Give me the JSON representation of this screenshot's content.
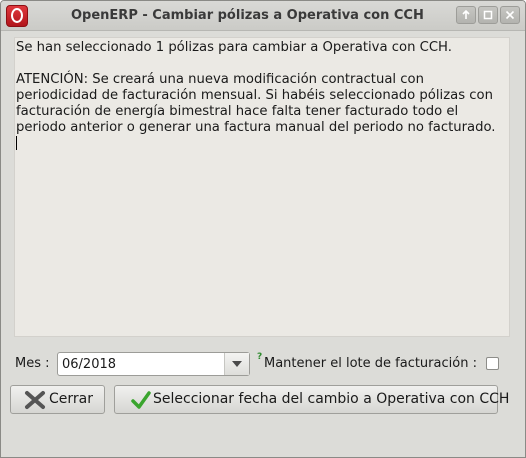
{
  "window": {
    "title": "OpenERP - Cambiar pólizas a Operativa con CCH",
    "app_icon": "openerp-logo-icon",
    "controls": [
      "pin-icon",
      "maximize-icon",
      "close-icon"
    ]
  },
  "message": {
    "line1": "Se han seleccionado 1 pólizas para cambiar a Operativa con CCH.",
    "warning": "ATENCIÓN: Se creará una nueva modificación contractual con periodicidad de facturación mensual. Si habéis seleccionado pólizas con facturación de energía bimestral hace falta tener facturado todo el periodo anterior o generar una factura manual del periodo no facturado."
  },
  "form": {
    "mes_label": "Mes :",
    "mes_value": "06/2018",
    "help_mark": "?",
    "keep_label": "Mantener el lote de facturación :",
    "keep_checked": false
  },
  "buttons": {
    "cancel": "Cerrar",
    "confirm": "Seleccionar fecha del cambio a Operativa con CCH"
  },
  "colors": {
    "icon_red": "#c1191f",
    "confirm_green": "#3aa52e",
    "cancel_gray": "#5a5a5a"
  }
}
